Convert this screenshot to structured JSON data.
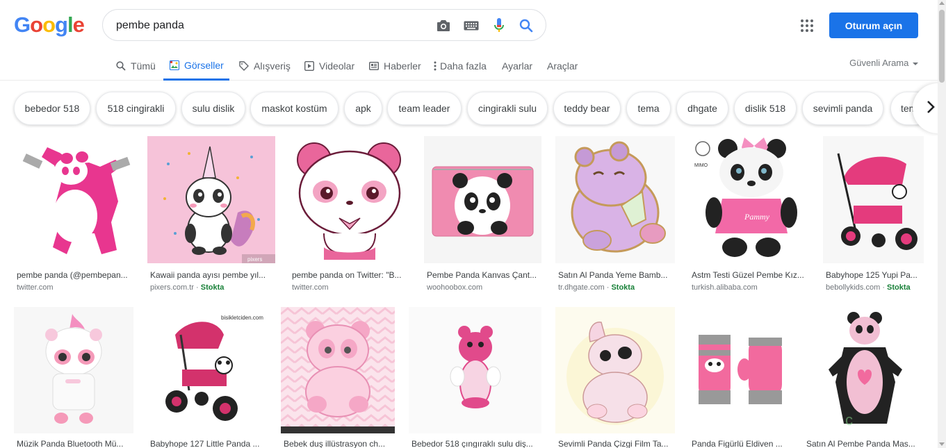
{
  "logo": "Google",
  "search": {
    "query": "pembe panda"
  },
  "header": {
    "signin_label": "Oturum açın"
  },
  "tabs": [
    {
      "label": "Tümü",
      "icon": "search-icon"
    },
    {
      "label": "Görseller",
      "icon": "image-icon",
      "active": true
    },
    {
      "label": "Alışveriş",
      "icon": "tag-icon"
    },
    {
      "label": "Videolar",
      "icon": "play-icon"
    },
    {
      "label": "Haberler",
      "icon": "news-icon"
    },
    {
      "label": "Daha fazla",
      "icon": "more-vert-icon"
    },
    {
      "label": "Ayarlar"
    },
    {
      "label": "Araçlar"
    }
  ],
  "safe_search": "Güvenli Arama",
  "chips": [
    "bebedor 518",
    "518 cingirakli",
    "sulu dislik",
    "maskot kostüm",
    "apk",
    "team leader",
    "cingirakli sulu",
    "teddy bear",
    "tema",
    "dhgate",
    "dislik 518",
    "sevimli panda",
    "tema"
  ],
  "results_row1": [
    {
      "title": "pembe panda (@pembepan...",
      "source": "twitter.com",
      "stock": ""
    },
    {
      "title": "Kawaii panda ayısı pembe yıl...",
      "source": "pixers.com.tr",
      "stock": "Stokta"
    },
    {
      "title": "pembe panda on Twitter: \"B...",
      "source": "twitter.com",
      "stock": ""
    },
    {
      "title": "Pembe Panda Kanvas Çant...",
      "source": "woohoobox.com",
      "stock": ""
    },
    {
      "title": "Satın Al Panda Yeme Bamb...",
      "source": "tr.dhgate.com",
      "stock": "Stokta"
    },
    {
      "title": "Astm Testi Güzel Pembe Kız...",
      "source": "turkish.alibaba.com",
      "stock": ""
    },
    {
      "title": "Babyhope 125 Yupi Pa...",
      "source": "bebollykids.com",
      "stock": "Stokta"
    }
  ],
  "results_row2": [
    {
      "title": "Müzik Panda Bluetooth Mü..."
    },
    {
      "title": "Babyhope 127 Little Panda ..."
    },
    {
      "title": "Bebek duş illüstrasyon ch..."
    },
    {
      "title": "Bebedor 518 çıngıraklı sulu diş..."
    },
    {
      "title": "Sevimli Panda Çizgi Film Ta..."
    },
    {
      "title": "Panda Figürlü Eldiven ..."
    },
    {
      "title": "Satın Al Pembe Panda Mas..."
    }
  ],
  "image_text": {
    "pixers_watermark": "pixers",
    "bisiklet_watermark": "bisikletciden.com",
    "mimo_label": "MIMO",
    "pammy_label": "Pammy"
  },
  "colors": {
    "accent": "#1a73e8",
    "pink": "#e8368f",
    "stock_green": "#188038"
  }
}
